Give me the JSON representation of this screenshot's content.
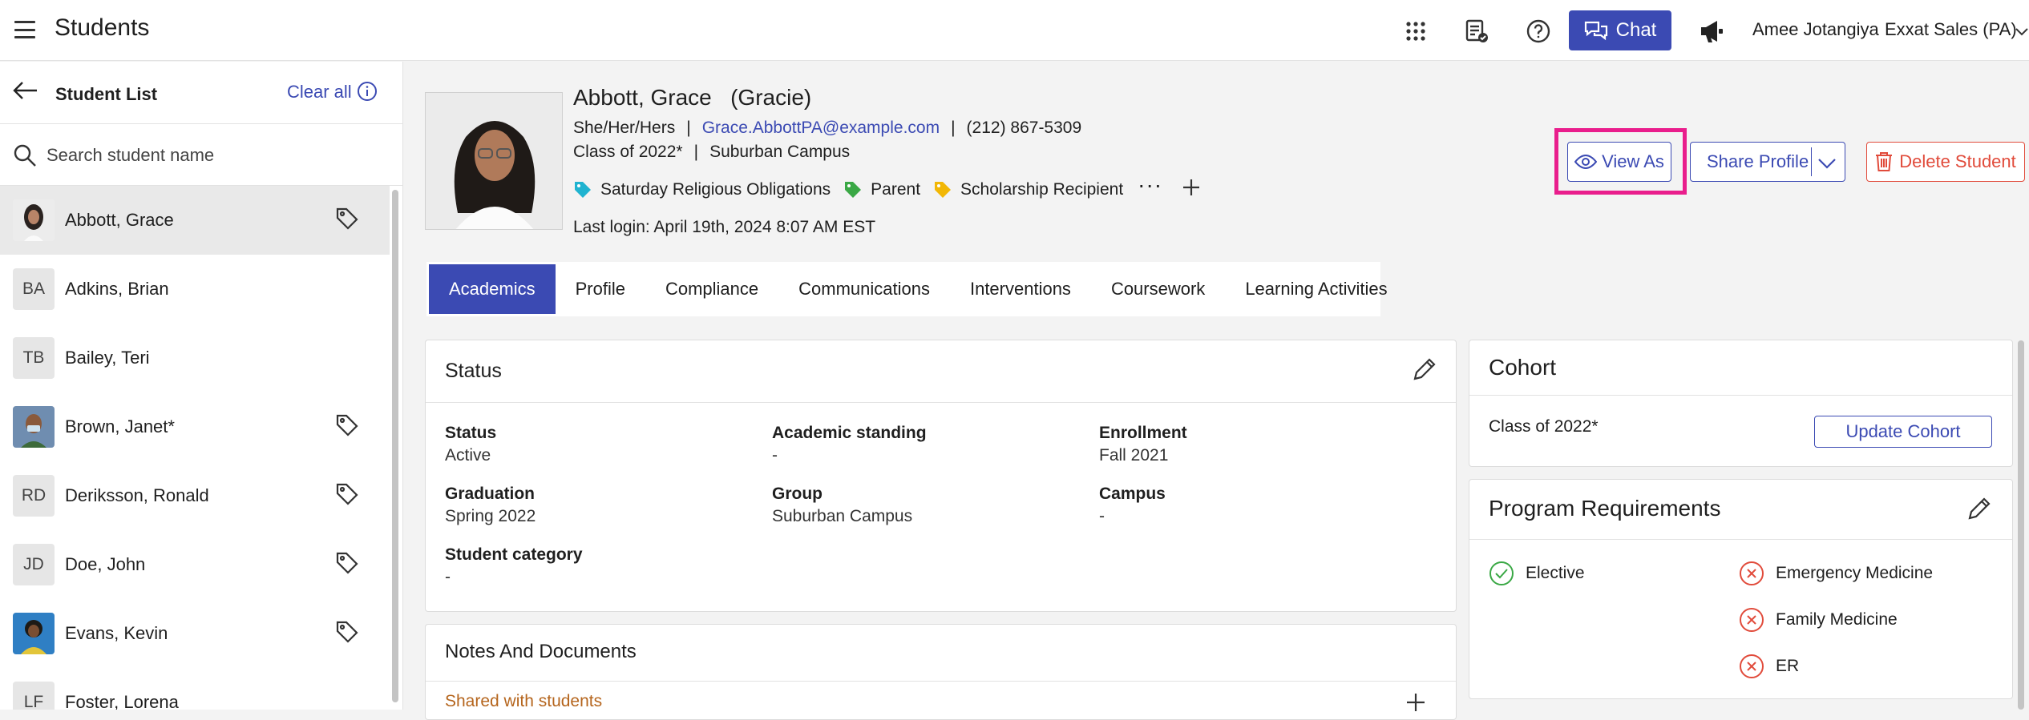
{
  "topbar": {
    "title": "Students",
    "chat_label": "Chat",
    "user_name": "Amee Jotangiya",
    "org_name": "Exxat Sales (PA)",
    "brand_color": "#3b4ab3"
  },
  "sidebar": {
    "title": "Student List",
    "clear_all": "Clear all",
    "search_placeholder": "Search student name",
    "students": [
      {
        "name": "Abbott, Grace",
        "initials": "",
        "photo": true,
        "tagged": true,
        "active": true
      },
      {
        "name": "Adkins, Brian",
        "initials": "BA",
        "photo": false,
        "tagged": false
      },
      {
        "name": "Bailey, Teri",
        "initials": "TB",
        "photo": false,
        "tagged": false
      },
      {
        "name": "Brown, Janet*",
        "initials": "",
        "photo": true,
        "tagged": true
      },
      {
        "name": "Deriksson, Ronald",
        "initials": "RD",
        "photo": false,
        "tagged": true
      },
      {
        "name": "Doe, John",
        "initials": "JD",
        "photo": false,
        "tagged": true
      },
      {
        "name": "Evans, Kevin",
        "initials": "",
        "photo": true,
        "tagged": true
      },
      {
        "name": "Foster, Lorena",
        "initials": "LF",
        "photo": false,
        "tagged": false
      }
    ]
  },
  "profile": {
    "name": "Abbott, Grace",
    "nickname": "(Gracie)",
    "pronouns": "She/Her/Hers",
    "email": "Grace.AbbottPA@example.com",
    "phone": "(212) 867-5309",
    "class": "Class of 2022*",
    "campus": "Suburban Campus",
    "tags": [
      {
        "label": "Saturday Religious Obligations",
        "color": "#1fb3d0"
      },
      {
        "label": "Parent",
        "color": "#3aa845"
      },
      {
        "label": "Scholarship Recipient",
        "color": "#f2b705"
      }
    ],
    "last_login": "Last login: April 19th, 2024 8:07 AM EST",
    "sep": "|"
  },
  "actions": {
    "view_as": "View As",
    "share_profile": "Share Profile",
    "delete_student": "Delete Student"
  },
  "tabs": [
    "Academics",
    "Profile",
    "Compliance",
    "Communications",
    "Interventions",
    "Coursework",
    "Learning Activities"
  ],
  "status_card": {
    "title": "Status",
    "fields": {
      "status": {
        "label": "Status",
        "value": "Active"
      },
      "academic_standing": {
        "label": "Academic standing",
        "value": "-"
      },
      "enrollment": {
        "label": "Enrollment",
        "value": "Fall 2021"
      },
      "graduation": {
        "label": "Graduation",
        "value": "Spring 2022"
      },
      "group": {
        "label": "Group",
        "value": "Suburban Campus"
      },
      "campus": {
        "label": "Campus",
        "value": "-"
      },
      "student_category": {
        "label": "Student category",
        "value": "-"
      }
    }
  },
  "notes_card": {
    "title": "Notes And Documents",
    "shared_label": "Shared with students"
  },
  "cohort_card": {
    "title": "Cohort",
    "value": "Class of 2022*",
    "update_label": "Update Cohort"
  },
  "requirements_card": {
    "title": "Program Requirements",
    "items": [
      {
        "label": "Elective",
        "met": true
      },
      {
        "label": "Emergency Medicine",
        "met": false
      },
      {
        "label": "Family Medicine",
        "met": false
      },
      {
        "label": "ER",
        "met": false
      }
    ]
  }
}
